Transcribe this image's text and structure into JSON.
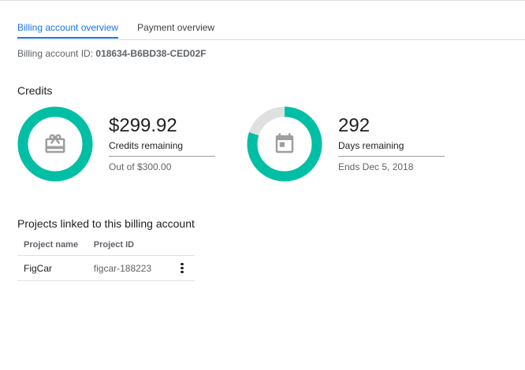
{
  "tabs": [
    {
      "label": "Billing account overview",
      "active": true
    },
    {
      "label": "Payment overview",
      "active": false
    }
  ],
  "billing_account": {
    "id_label": "Billing account ID:",
    "id_value": "018634-B6BD38-CED02F"
  },
  "credits": {
    "section_title": "Credits",
    "credits_card": {
      "value": "$299.92",
      "label": "Credits remaining",
      "sub": "Out of $300.00",
      "ring_fraction": 0.9997,
      "icon": "card-giftcard-icon"
    },
    "days_card": {
      "value": "292",
      "label": "Days remaining",
      "sub": "Ends Dec 5, 2018",
      "ring_fraction": 0.8,
      "icon": "calendar-icon"
    }
  },
  "projects": {
    "section_title": "Projects linked to this billing account",
    "columns": [
      "Project name",
      "Project ID"
    ],
    "rows": [
      {
        "name": "FigCar",
        "id": "figcar-188223"
      }
    ]
  },
  "colors": {
    "accent": "#1a73e8",
    "ring_fill": "#00bfa5",
    "ring_track": "#e0e0e0",
    "icon_gray": "#9e9e9e"
  }
}
